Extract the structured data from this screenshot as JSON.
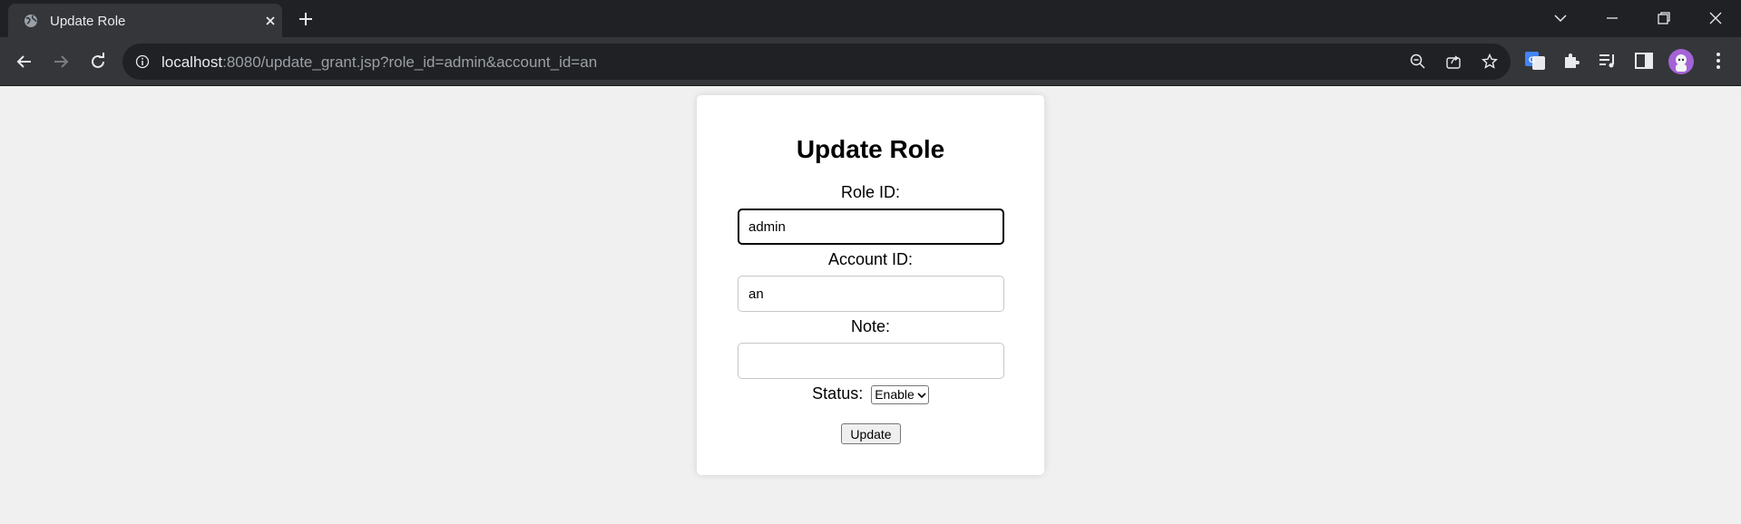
{
  "browser": {
    "tab_title": "Update Role",
    "url_host": "localhost",
    "url_rest": ":8080/update_grant.jsp?role_id=admin&account_id=an"
  },
  "form": {
    "title": "Update Role",
    "role_id_label": "Role ID:",
    "role_id_value": "admin",
    "account_id_label": "Account ID:",
    "account_id_value": "an",
    "note_label": "Note:",
    "note_value": "",
    "status_label": "Status:",
    "status_selected": "Enable",
    "update_label": "Update"
  },
  "colors": {
    "chrome_dark": "#202124",
    "chrome_tab": "#35363a",
    "page_bg": "#f0f0f0",
    "card_bg": "#ffffff"
  }
}
